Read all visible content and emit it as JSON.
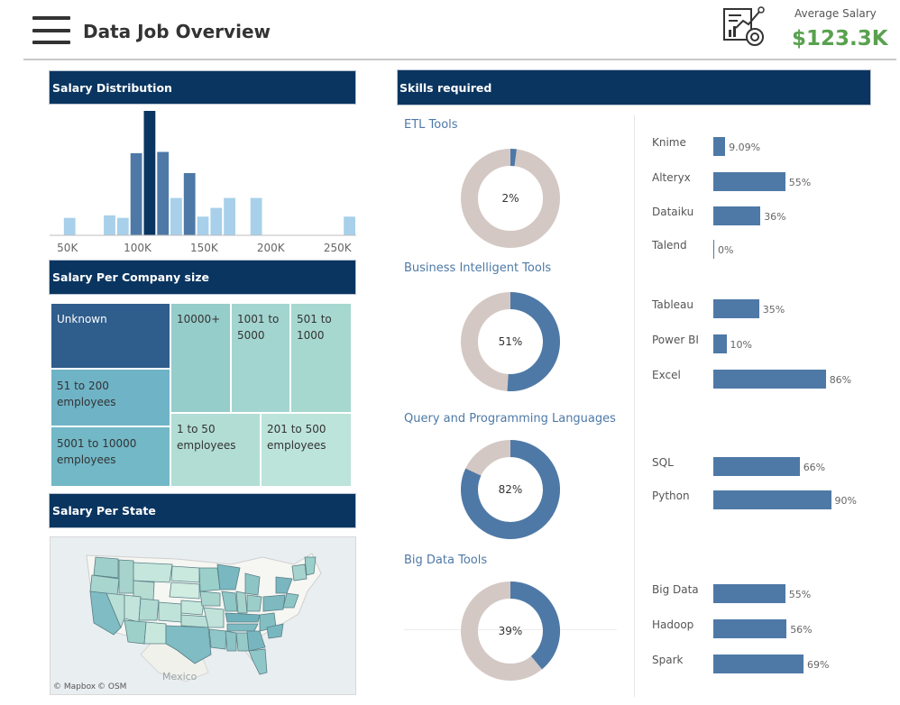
{
  "header": {
    "title": "Data Job Overview",
    "avg_salary_label": "Average Salary",
    "avg_salary_value": "$123.3K",
    "accent_color": "#59a14f"
  },
  "icons": {
    "menu": "hamburger-menu-icon",
    "analytics": "analytics-report-icon"
  },
  "sections": {
    "salary_distribution": "Salary Distribution",
    "salary_company_size": "Salary Per Company size",
    "salary_state": "Salary Per State",
    "skills": "Skills required"
  },
  "map": {
    "country_label": "Mexico",
    "credit_mapbox": "© Mapbox",
    "credit_osm": "© OSM"
  },
  "treemap": {
    "cells": [
      {
        "label": "Unknown"
      },
      {
        "label": "51 to 200 employees"
      },
      {
        "label": "5001 to 10000 employees"
      },
      {
        "label": "10000+"
      },
      {
        "label": "1001 to 5000"
      },
      {
        "label": "501 to 1000"
      },
      {
        "label": "1 to 50 employees"
      },
      {
        "label": "201 to 500 employees"
      }
    ]
  },
  "skill_groups": [
    {
      "title": "ETL Tools",
      "donut_percent": 2,
      "donut_label": "2%"
    },
    {
      "title": "Business Intelligent Tools",
      "donut_percent": 51,
      "donut_label": "51%"
    },
    {
      "title": "Query and Programming Languages",
      "donut_percent": 82,
      "donut_label": "82%"
    },
    {
      "title": "Big Data Tools",
      "donut_percent": 39,
      "donut_label": "39%"
    }
  ],
  "chart_data": [
    {
      "type": "bar",
      "title": "Salary Distribution",
      "xlabel": "",
      "ylabel": "",
      "x_ticks": [
        "50K",
        "100K",
        "150K",
        "200K",
        "250K"
      ],
      "x_tick_values": [
        50,
        100,
        150,
        200,
        250
      ],
      "xlim": [
        35,
        265
      ],
      "ylim": [
        0,
        100
      ],
      "bin_width": 10,
      "bins": [
        {
          "x": 50,
          "value": 14
        },
        {
          "x": 80,
          "value": 16
        },
        {
          "x": 90,
          "value": 14
        },
        {
          "x": 100,
          "value": 66
        },
        {
          "x": 110,
          "value": 100
        },
        {
          "x": 120,
          "value": 67
        },
        {
          "x": 130,
          "value": 30
        },
        {
          "x": 140,
          "value": 50
        },
        {
          "x": 150,
          "value": 15
        },
        {
          "x": 160,
          "value": 22
        },
        {
          "x": 170,
          "value": 30
        },
        {
          "x": 190,
          "value": 30
        },
        {
          "x": 260,
          "value": 15
        }
      ],
      "colors": [
        "#a8d0ea",
        "#4e79a7",
        "#0a3560"
      ]
    },
    {
      "type": "donut",
      "title": "ETL Tools",
      "values": [
        2,
        98
      ],
      "colors": [
        "#4e79a7",
        "#d4c8c4"
      ]
    },
    {
      "type": "donut",
      "title": "Business Intelligent Tools",
      "values": [
        51,
        49
      ],
      "colors": [
        "#4e79a7",
        "#d4c8c4"
      ]
    },
    {
      "type": "donut",
      "title": "Query and Programming Languages",
      "values": [
        82,
        18
      ],
      "colors": [
        "#4e79a7",
        "#d4c8c4"
      ]
    },
    {
      "type": "donut",
      "title": "Big Data Tools",
      "values": [
        39,
        61
      ],
      "colors": [
        "#4e79a7",
        "#d4c8c4"
      ]
    },
    {
      "type": "bar",
      "orientation": "horizontal",
      "xlim": [
        0,
        100
      ],
      "bar_color": "#4e79a7",
      "groups": [
        {
          "categories": [
            "Knime",
            "Alteryx",
            "Dataiku",
            "Talend"
          ],
          "values": [
            9.09,
            55,
            36,
            0
          ],
          "labels": [
            "9.09%",
            "55%",
            "36%",
            "0%"
          ]
        },
        {
          "categories": [
            "Tableau",
            "Power BI",
            "Excel"
          ],
          "values": [
            35,
            10,
            86
          ],
          "labels": [
            "35%",
            "10%",
            "86%"
          ]
        },
        {
          "categories": [
            "SQL",
            "Python"
          ],
          "values": [
            66,
            90
          ],
          "labels": [
            "66%",
            "90%"
          ]
        },
        {
          "categories": [
            "Big Data",
            "Hadoop",
            "Spark"
          ],
          "values": [
            55,
            56,
            69
          ],
          "labels": [
            "55%",
            "56%",
            "69%"
          ]
        }
      ]
    }
  ]
}
